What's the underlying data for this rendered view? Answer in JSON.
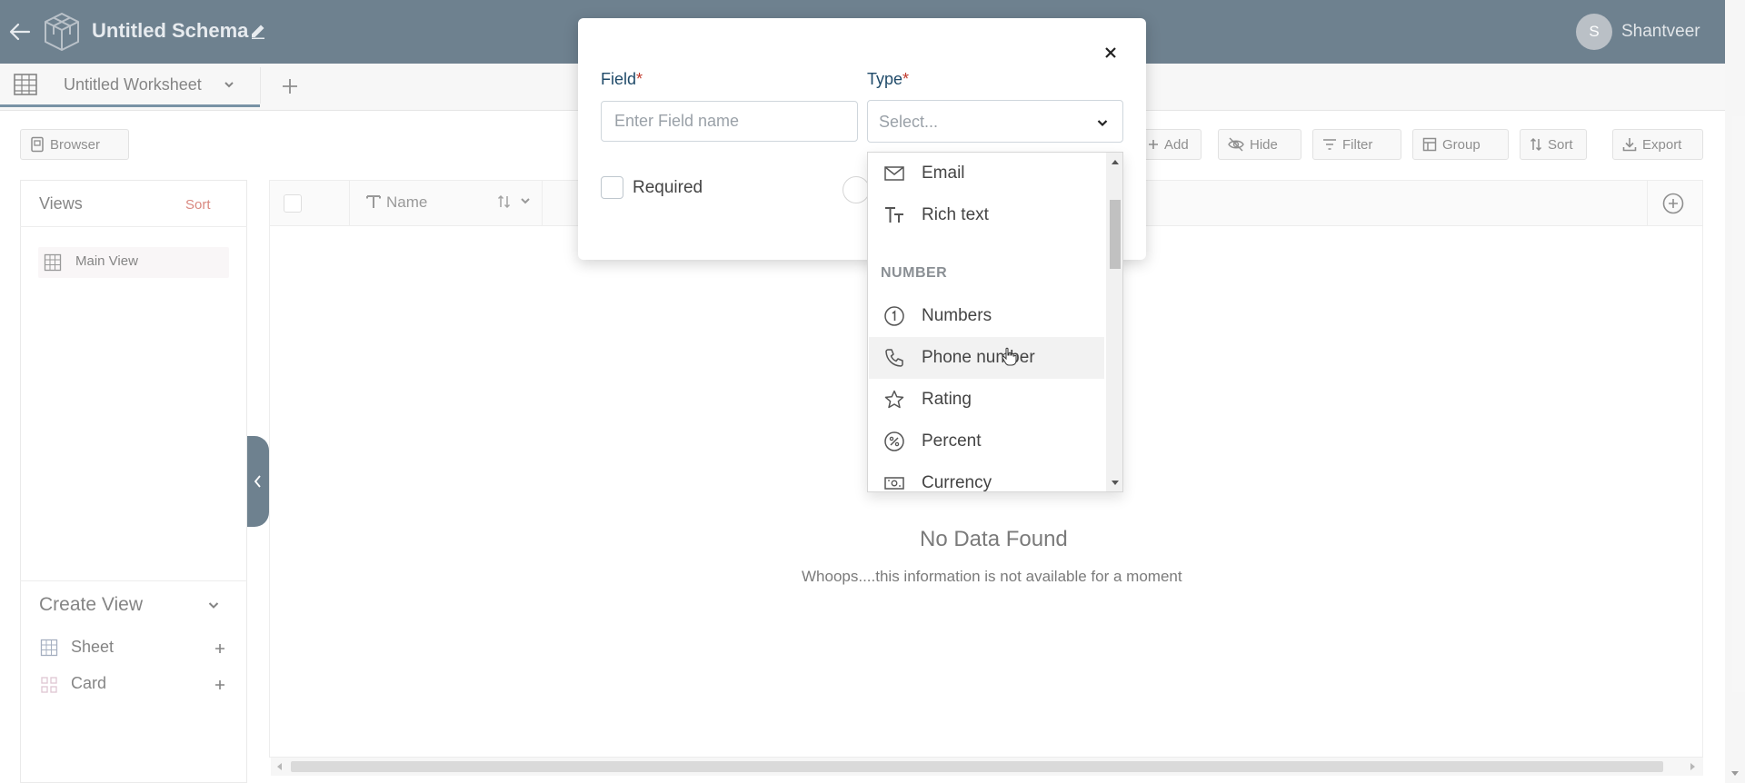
{
  "app": {
    "title": "Untitled Schema",
    "user_initial": "S",
    "user_name": "Shantveer"
  },
  "tabs": {
    "active_label": "Untitled Worksheet"
  },
  "toolbar": {
    "browser_label": "Browser",
    "add_label": "Add",
    "hide_label": "Hide",
    "filter_label": "Filter",
    "group_label": "Group",
    "sort_label": "Sort",
    "export_label": "Export"
  },
  "sidebar": {
    "views_title": "Views",
    "views_sort": "Sort",
    "main_view": "Main View",
    "create_view_title": "Create View",
    "create_items": [
      {
        "label": "Sheet",
        "icon": "grid-icon"
      },
      {
        "label": "Card",
        "icon": "cards-icon"
      }
    ]
  },
  "grid": {
    "column_name": "Name",
    "empty_title": "No Data Found",
    "empty_message": "Whoops....this information is not available for a moment"
  },
  "modal": {
    "field_label": "Field",
    "type_label": "Type",
    "required_mark": "*",
    "field_placeholder": "Enter Field name",
    "type_placeholder": "Select...",
    "required_label": "Required"
  },
  "dropdown": {
    "items_top": [
      {
        "label": "Email",
        "icon": "mail-icon"
      },
      {
        "label": "Rich text",
        "icon": "rich-text-icon"
      }
    ],
    "section": "NUMBER",
    "items_number": [
      {
        "label": "Numbers",
        "icon": "number-circle-icon"
      },
      {
        "label": "Phone number",
        "icon": "phone-icon"
      },
      {
        "label": "Rating",
        "icon": "star-icon"
      },
      {
        "label": "Percent",
        "icon": "percent-icon"
      },
      {
        "label": "Currency",
        "icon": "currency-icon"
      }
    ],
    "hovered_item": "Phone number"
  },
  "colors": {
    "topbar": "#0e2d45",
    "accent_red": "#c0392b",
    "label_blue": "#1f4a69"
  }
}
